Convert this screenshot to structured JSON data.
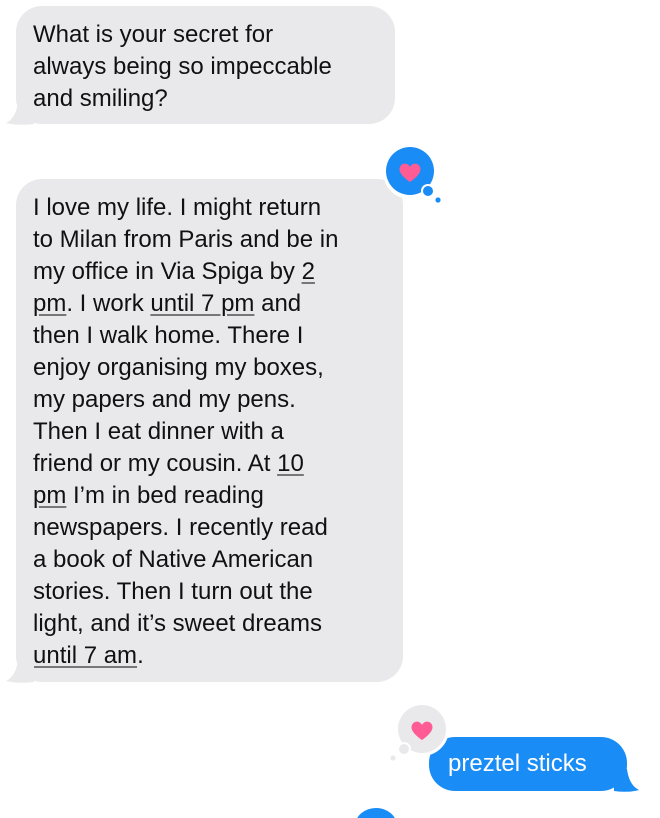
{
  "messages": [
    {
      "direction": "incoming",
      "text": "What is your secret for\nalways being so impeccable\nand smiling?"
    },
    {
      "direction": "incoming",
      "text_parts": [
        "I love my life. I might return\nto Milan from Paris and be in\nmy office in Via Spiga by ",
        "2\npm",
        ". I work ",
        "until 7 pm",
        " and\nthen I walk home. There I\nenjoy organising my boxes,\nmy papers and my pens.\nThen I eat dinner with a\nfriend or my cousin. At ",
        "10\npm",
        " I’m in bed reading\nnewspapers. I recently read\na book of Native American\nstories. Then I turn out the\nlight, and it’s sweet dreams\n",
        "until 7 am",
        "."
      ],
      "reaction": {
        "icon": "heart-icon",
        "style": "sent-by-me",
        "color": "#1a8cf5"
      }
    },
    {
      "direction": "outgoing",
      "text": "preztel sticks",
      "reaction": {
        "icon": "heart-icon",
        "style": "received",
        "color": "#e9e9eb"
      }
    }
  ],
  "colors": {
    "incoming_bubble": "#e9e9eb",
    "outgoing_bubble": "#1a8cf5",
    "heart": "#ff5b94"
  }
}
